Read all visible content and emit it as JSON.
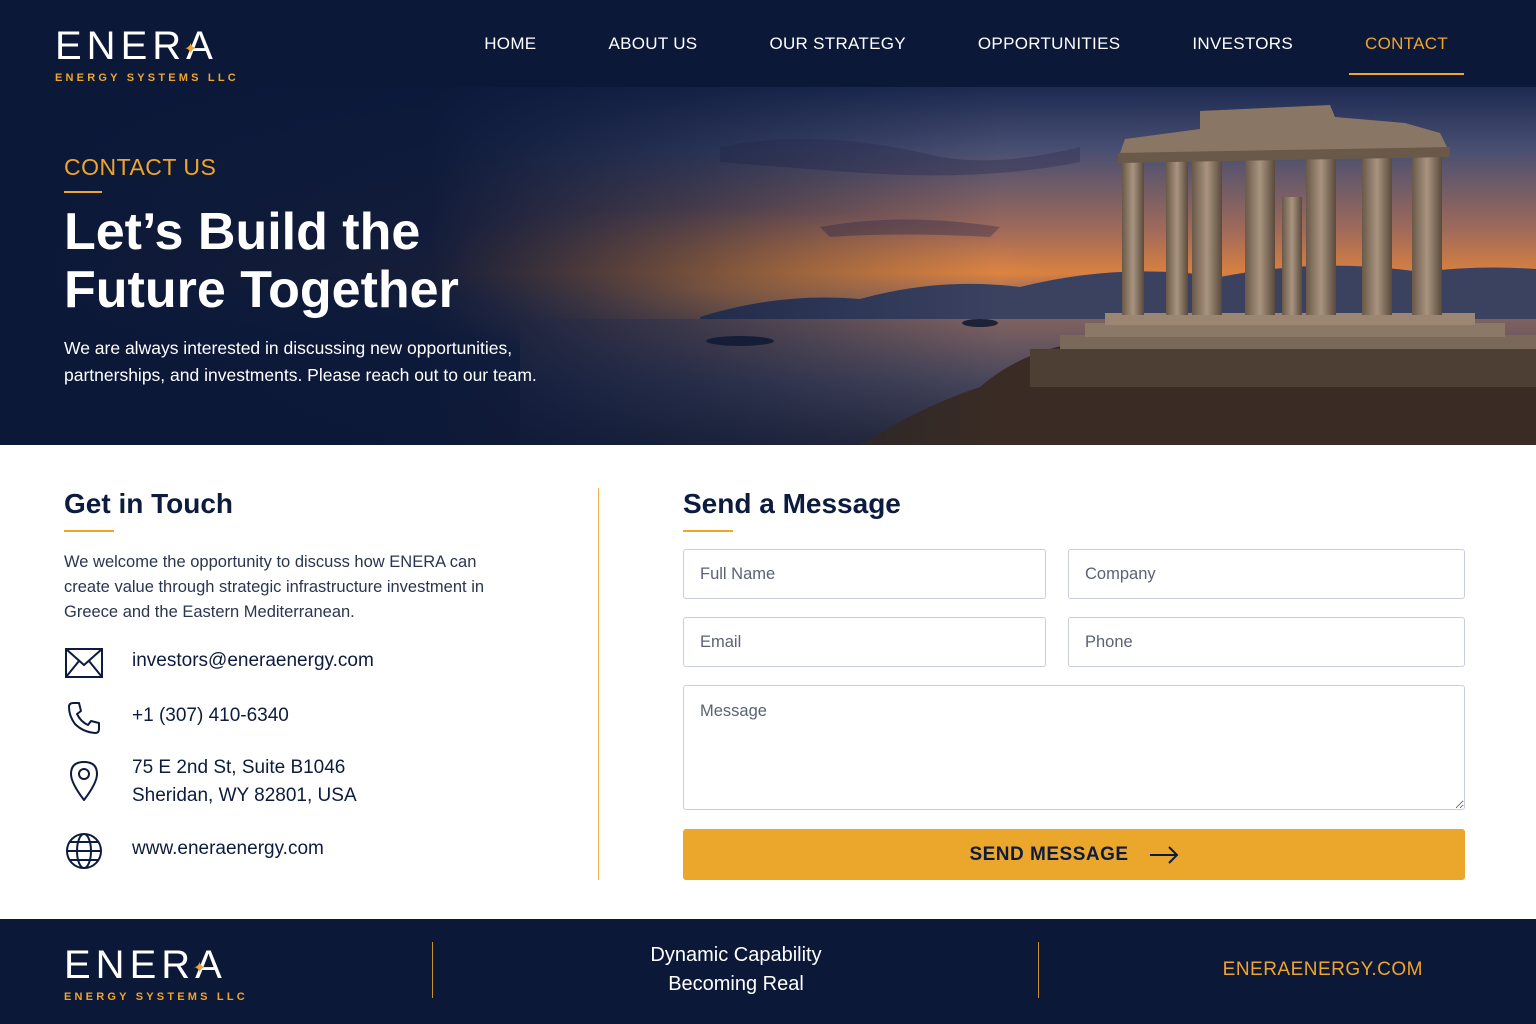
{
  "brand": {
    "name": "ENERA",
    "subtitle": "ENERGY SYSTEMS LLC"
  },
  "nav": {
    "items": [
      {
        "label": "HOME",
        "name": "nav-item-home"
      },
      {
        "label": "ABOUT US",
        "name": "nav-item-about-us"
      },
      {
        "label": "OUR STRATEGY",
        "name": "nav-item-our-strategy"
      },
      {
        "label": "OPPORTUNITIES",
        "name": "nav-item-opportunities"
      },
      {
        "label": "INVESTORS",
        "name": "nav-item-investors"
      },
      {
        "label": "CONTACT",
        "name": "nav-item-contact"
      }
    ],
    "active": "CONTACT"
  },
  "hero": {
    "eyebrow": "CONTACT US",
    "title": "Let’s Build the Future Together",
    "text": "We are always interested in discussing new opportunities, partnerships, and investments. Please reach out to our team."
  },
  "contact": {
    "heading": "Get in Touch",
    "intro": "We welcome the opportunity to discuss how ENERA can create value through strategic infrastructure investment in Greece and the Eastern Mediterranean.",
    "email": "investors@eneraenergy.com",
    "phone": "+1 (307) 410-6340",
    "address_line1": "75 E 2nd St, Suite B1046",
    "address_line2": "Sheridan, WY 82801, USA",
    "website": "www.eneraenergy.com",
    "icons": [
      "envelope-icon",
      "phone-icon",
      "map-pin-icon",
      "globe-icon"
    ]
  },
  "form": {
    "heading": "Send a Message",
    "full_name_placeholder": "Full Name",
    "company_placeholder": "Company",
    "email_placeholder": "Email",
    "phone_placeholder": "Phone",
    "message_placeholder": "Message",
    "submit_label": "SEND MESSAGE"
  },
  "footer": {
    "tagline_line1": "Dynamic Capability",
    "tagline_line2": "Becoming Real",
    "url": "ENERAENERGY.COM"
  },
  "colors": {
    "navy": "#0b1838",
    "accent": "#f0a52a",
    "button": "#eba72b",
    "text": "#0d1b3e"
  }
}
